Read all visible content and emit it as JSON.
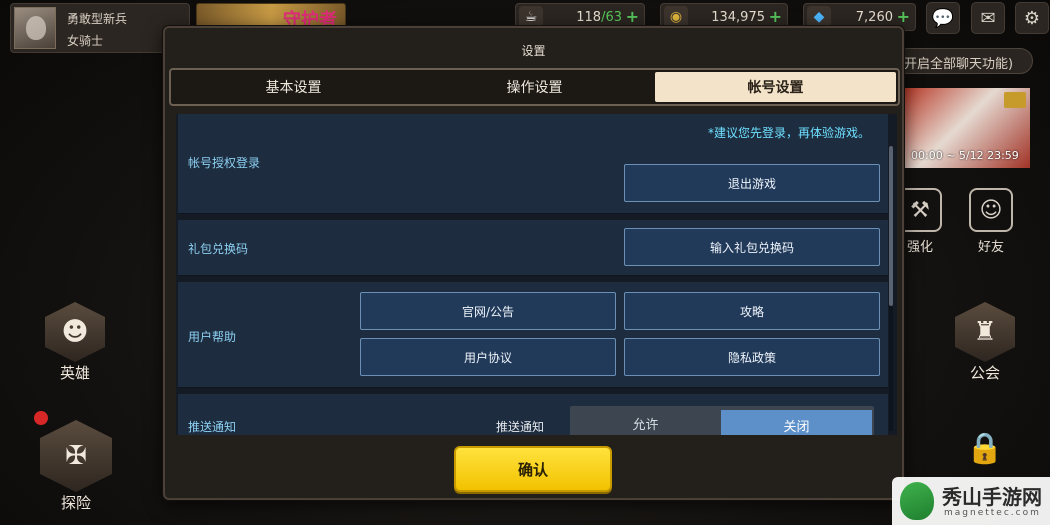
{
  "player": {
    "rank": "勇敢型新兵",
    "job": "女骑士"
  },
  "banner": {
    "text": "守护者"
  },
  "resources": [
    {
      "icon": "coffee-icon",
      "current": "118",
      "max": "/63"
    },
    {
      "icon": "coin-icon",
      "value": "134,975"
    },
    {
      "icon": "gem-icon",
      "value": "7,260"
    }
  ],
  "chat": {
    "text": "开启全部聊天功能)"
  },
  "event": {
    "time": "00:00 ~ 5/12 23:59"
  },
  "side_right": {
    "enhance": "强化",
    "friends": "好友",
    "guild": "公会"
  },
  "side_left": {
    "hero": "英雄",
    "explore": "探险"
  },
  "dialog": {
    "title": "设置",
    "tabs": [
      "基本设置",
      "操作设置",
      "帐号设置"
    ],
    "active_tab": 2,
    "account": {
      "label": "帐号授权登录",
      "note": "*建议您先登录，再体验游戏。",
      "logout_button": "退出游戏"
    },
    "gift": {
      "label": "礼包兑换码",
      "button": "输入礼包兑换码"
    },
    "help": {
      "label": "用户帮助",
      "buttons": [
        "官网/公告",
        "攻略",
        "用户协议",
        "隐私政策"
      ]
    },
    "push": {
      "label": "推送通知",
      "toggle_label": "推送通知",
      "options": [
        "允许",
        "关闭"
      ],
      "selected": "关闭"
    },
    "confirm": "确认"
  },
  "watermark": {
    "name": "秀山手游网",
    "domain": "magnettec.com"
  }
}
